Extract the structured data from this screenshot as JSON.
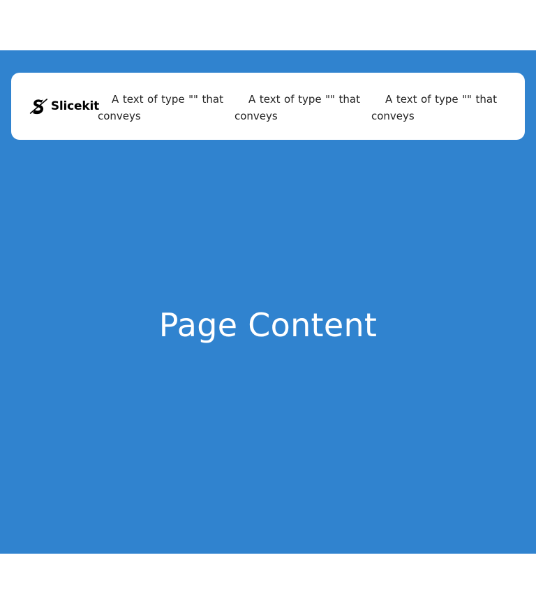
{
  "navbar": {
    "logo": {
      "icon": "slicekit-logo-icon",
      "text": "Slicekit"
    },
    "items": [
      {
        "label": "A text of type \"\" that conveys"
      },
      {
        "label": "A text of type \"\" that conveys"
      },
      {
        "label": "A text of type \"\" that conveys"
      }
    ]
  },
  "hero": {
    "title": "Page Content"
  },
  "colors": {
    "hero_background": "#3083cf",
    "navbar_background": "#ffffff",
    "hero_text": "#ffffff",
    "nav_text": "#222222"
  }
}
